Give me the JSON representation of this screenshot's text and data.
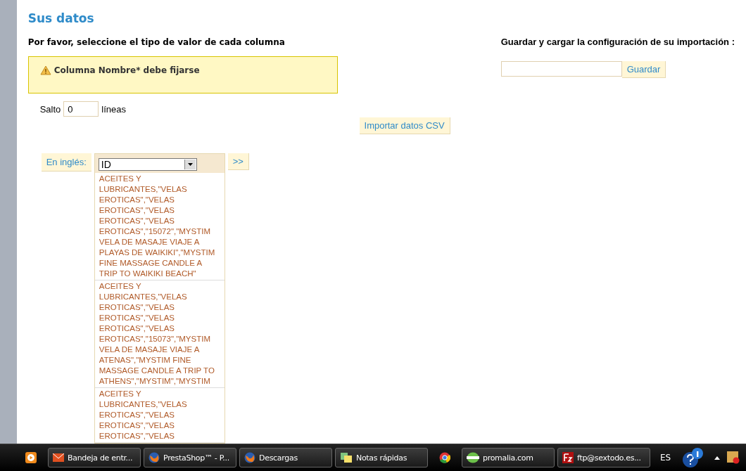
{
  "page": {
    "title": "Sus datos",
    "instruction": "Por favor, seleccione el tipo de valor de cada columna",
    "warning": "Columna Nombre* debe fijarse",
    "skip": {
      "label_before": "Salto",
      "value": "0",
      "label_after": "líneas"
    },
    "import_button": "Importar datos CSV",
    "config": {
      "title": "Guardar y cargar la configuración de su importación :",
      "save_button": "Guardar"
    },
    "column": {
      "label": "En inglés:",
      "select_value": "ID",
      "next_button": ">>",
      "cells": [
        "ACEITES Y LUBRICANTES,\"VELAS EROTICAS\",\"VELAS EROTICAS\",\"VELAS EROTICAS\",\"VELAS EROTICAS\",\"15072\",\"MYSTIM VELA DE MASAJE VIAJE A PLAYAS DE WAIKIKI\",\"MYSTIM FINE MASSAGE CANDLE A TRIP TO WAIKIKI BEACH\"",
        "ACEITES Y LUBRICANTES,\"VELAS EROTICAS\",\"VELAS EROTICAS\",\"VELAS EROTICAS\",\"VELAS EROTICAS\",\"15073\",\"MYSTIM VELA DE MASAJE VIAJE A ATENAS\",\"MYSTIM FINE MASSAGE CANDLE A TRIP TO ATHENS\",\"MYSTIM\",\"MYSTIM",
        "ACEITES Y LUBRICANTES,\"VELAS EROTICAS\",\"VELAS EROTICAS\",\"VELAS EROTICAS\",\"VELAS"
      ]
    }
  },
  "taskbar": {
    "items": [
      {
        "kind": "icon"
      },
      {
        "kind": "button",
        "label": "Bandeja de entr..."
      },
      {
        "kind": "button",
        "label": "PrestaShop™ - P..."
      },
      {
        "kind": "button",
        "label": "Descargas"
      },
      {
        "kind": "button",
        "label": "Notas rápidas"
      },
      {
        "kind": "icon"
      },
      {
        "kind": "button",
        "label": "promalia.com"
      },
      {
        "kind": "button",
        "label": "ftp@sextodo.es..."
      }
    ],
    "language": "ES"
  }
}
